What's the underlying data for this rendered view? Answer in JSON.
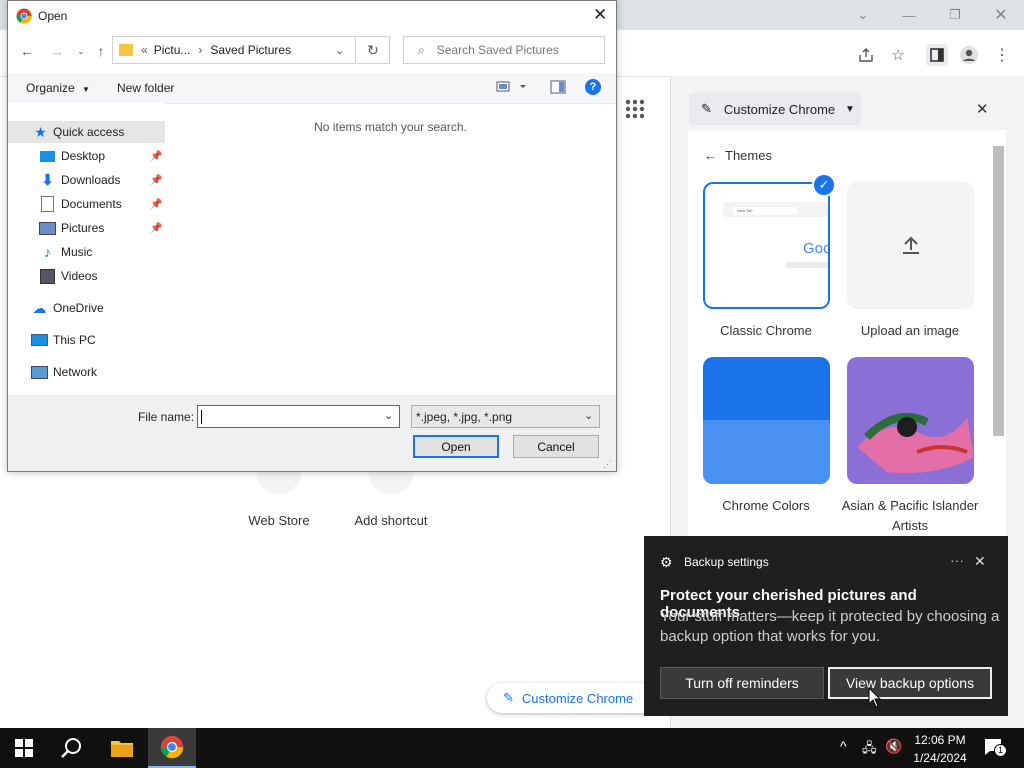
{
  "dialog": {
    "title": "Open",
    "breadcrumb_prefix": "«",
    "breadcrumb_parent": "Pictu...",
    "breadcrumb_sep": "›",
    "breadcrumb_current": "Saved Pictures",
    "search_placeholder": "Search Saved Pictures",
    "organize_label": "Organize",
    "new_folder_label": "New folder",
    "empty_message": "No items match your search.",
    "nav_items": [
      {
        "label": "Quick access"
      },
      {
        "label": "Desktop"
      },
      {
        "label": "Downloads"
      },
      {
        "label": "Documents"
      },
      {
        "label": "Pictures"
      },
      {
        "label": "Music"
      },
      {
        "label": "Videos"
      },
      {
        "label": "OneDrive"
      },
      {
        "label": "This PC"
      },
      {
        "label": "Network"
      }
    ],
    "file_name_label": "File name:",
    "file_name_value": "",
    "file_type_value": "*.jpeg, *.jpg, *.png",
    "open_button": "Open",
    "cancel_button": "Cancel"
  },
  "chrome": {
    "shortcuts": [
      {
        "label": "Web Store"
      },
      {
        "label": "Add shortcut"
      }
    ],
    "customize_button": "Customize Chrome"
  },
  "side_panel": {
    "header_select": "Customize Chrome",
    "section_title": "Themes",
    "themes": [
      {
        "label": "Classic Chrome",
        "selected": true
      },
      {
        "label": "Upload an image"
      },
      {
        "label": "Chrome Colors"
      },
      {
        "label": "Asian & Pacific Islander Artists"
      }
    ],
    "preview_text": "Goo",
    "preview_tab": "New Tab"
  },
  "notification": {
    "app": "Backup settings",
    "title": "Protect your cherished pictures and documents",
    "body": "Your stuff matters—keep it protected by choosing a backup option that works for you.",
    "button_secondary": "Turn off reminders",
    "button_primary": "View backup options"
  },
  "taskbar": {
    "time": "12:06 PM",
    "date": "1/24/2024",
    "notification_count": "1"
  },
  "colors": {
    "accent_blue": "#1a73e8",
    "toast_bg": "#1f1f1f",
    "taskbar_bg": "#101010"
  }
}
